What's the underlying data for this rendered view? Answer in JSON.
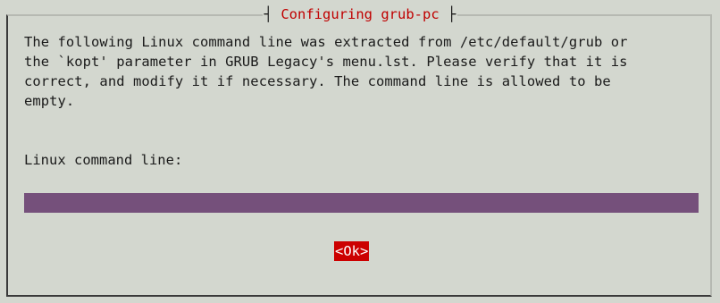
{
  "dialog": {
    "title": "Configuring grub-pc",
    "title_left_bar": "┤",
    "title_right_bar": "├",
    "message": "The following Linux command line was extracted from /etc/default/grub or\nthe `kopt' parameter in GRUB Legacy's menu.lst. Please verify that it is\ncorrect, and modify it if necessary. The command line is allowed to be\nempty.",
    "field_label": "Linux command line:",
    "field_value": "",
    "ok_label": "<Ok>"
  },
  "colors": {
    "background": "#d3d7cf",
    "title": "#c00000",
    "input_background": "#75507b",
    "button_background": "#cc0000",
    "button_text": "#ffffff"
  }
}
